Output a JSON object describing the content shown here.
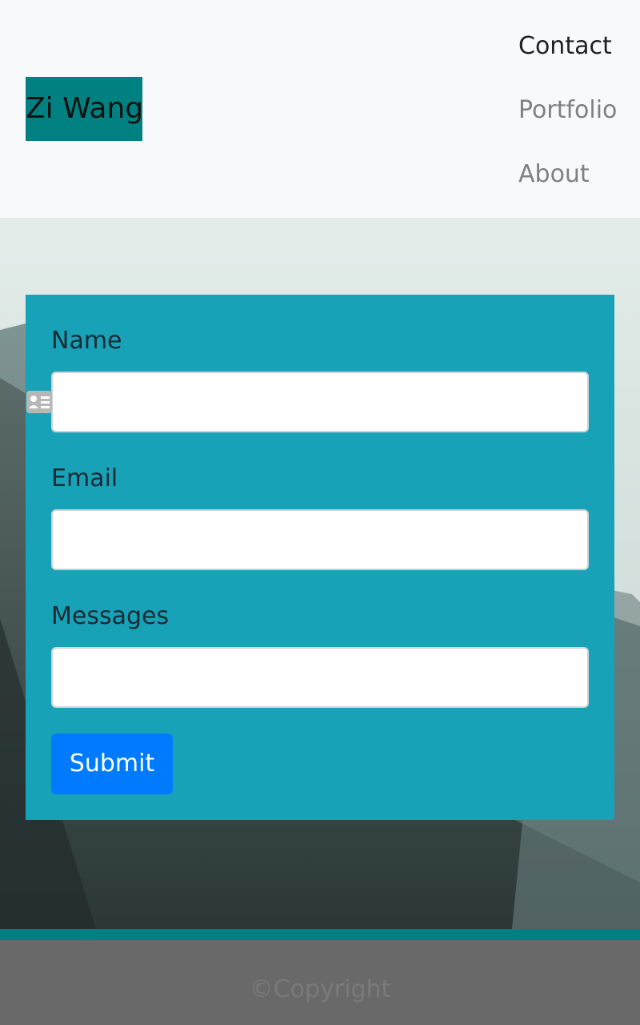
{
  "navbar": {
    "brand": "Zi Wang",
    "items": [
      {
        "label": "Contact",
        "active": true
      },
      {
        "label": "Portfolio",
        "active": false
      },
      {
        "label": "About",
        "active": false
      }
    ]
  },
  "form": {
    "fields": [
      {
        "label": "Name",
        "value": "",
        "icon": "contact-card-icon"
      },
      {
        "label": "Email",
        "value": ""
      },
      {
        "label": "Messages",
        "value": ""
      }
    ],
    "submit_label": "Submit"
  },
  "footer": {
    "text": "©Copyright"
  },
  "colors": {
    "brand_bg": "#008080",
    "form_bg": "#18a2b8",
    "submit_bg": "#007bff",
    "footer_bg": "#696969",
    "navbar_bg": "#f8f9fa"
  }
}
